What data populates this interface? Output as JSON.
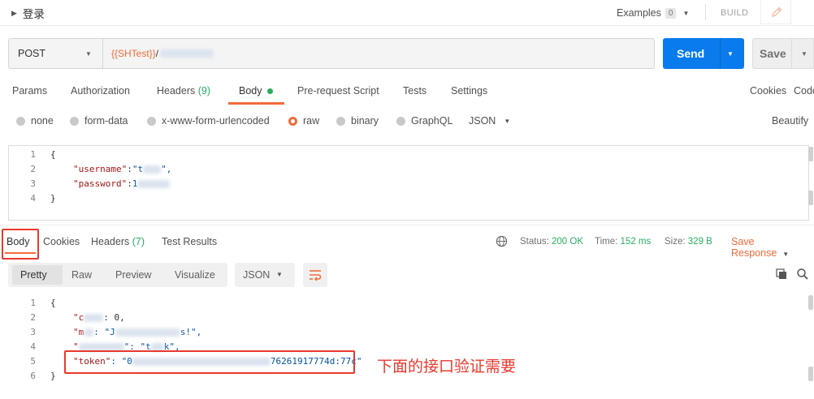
{
  "header": {
    "title": "登录",
    "examples_label": "Examples",
    "examples_count": "0",
    "build_label": "BUILD"
  },
  "request": {
    "method": "POST",
    "url_var": "{{SHTest}}",
    "url_sep": "/",
    "send_label": "Send",
    "save_label": "Save"
  },
  "tabs": {
    "params": "Params",
    "authorization": "Authorization",
    "headers": "Headers",
    "headers_count": "(9)",
    "body": "Body",
    "prerequest": "Pre-request Script",
    "tests": "Tests",
    "settings": "Settings",
    "cookies": "Cookies",
    "code": "Code"
  },
  "body_options": {
    "none": "none",
    "form_data": "form-data",
    "urlencoded": "x-www-form-urlencoded",
    "raw": "raw",
    "binary": "binary",
    "graphql": "GraphQL",
    "format": "JSON",
    "beautify": "Beautify"
  },
  "request_body": {
    "lines": [
      "1",
      "2",
      "3",
      "4"
    ],
    "open_brace": "{",
    "username_key": "\"username\"",
    "colon": ":",
    "username_val_prefix": "\"t",
    "username_val_suffix": "\",",
    "password_key": "\"password\"",
    "password_val_prefix": "1",
    "close_brace": "}"
  },
  "response_tabs": {
    "body": "Body",
    "cookies": "Cookies",
    "headers": "Headers",
    "headers_count": "(7)",
    "test_results": "Test Results",
    "status_label": "Status:",
    "status_value": "200 OK",
    "time_label": "Time:",
    "time_value": "152 ms",
    "size_label": "Size:",
    "size_value": "329 B",
    "save_response": "Save Response"
  },
  "response_view": {
    "pretty": "Pretty",
    "raw": "Raw",
    "preview": "Preview",
    "visualize": "Visualize",
    "format": "JSON"
  },
  "response_body": {
    "lines": [
      "1",
      "2",
      "3",
      "4",
      "5",
      "6"
    ],
    "open_brace": "{",
    "line2_key_prefix": "\"c",
    "line2_val": ": 0,",
    "line3_key_prefix": "\"m",
    "line3_rest": ": \"J",
    "line3_suffix": "s!\",",
    "line4_prefix": "\"",
    "line4_mid": "\": \"t",
    "line4_suffix": "k\",",
    "token_key": "\"token\"",
    "token_sep": ": \"0",
    "token_tail": "76261917774d:77c\"",
    "close_brace": "}"
  },
  "annotation": {
    "text": "下面的接口验证需要",
    "color": "#e8392e"
  }
}
